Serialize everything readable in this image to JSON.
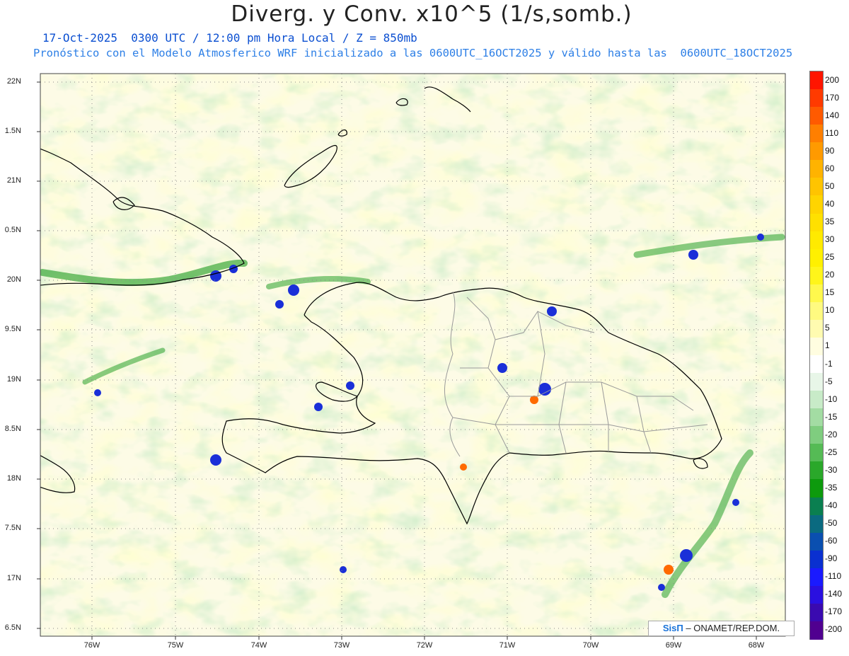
{
  "header": {
    "title": "Diverg. y Conv. x10^5 (1/s,somb.)",
    "subtitle1": "17-Oct-2025  0300 UTC / 12:00 pm Hora Local / Z = 850mb",
    "subtitle2": "Pronóstico con el Modelo Atmosferico WRF inicializado a las 0600UTC_16OCT2025 y válido hasta las  0600UTC_18OCT2025"
  },
  "axes": {
    "lat_labels": [
      "22N",
      "1.5N",
      "21N",
      "0.5N",
      "20N",
      "9.5N",
      "19N",
      "8.5N",
      "18N",
      "7.5N",
      "17N",
      "6.5N"
    ],
    "lon_labels": [
      "76W",
      "75W",
      "74W",
      "73W",
      "72W",
      "71W",
      "70W",
      "69W",
      "68W"
    ]
  },
  "colorbar": {
    "labels": [
      "200",
      "170",
      "140",
      "110",
      "90",
      "60",
      "50",
      "40",
      "35",
      "30",
      "25",
      "20",
      "15",
      "10",
      "5",
      "1",
      "-1",
      "-5",
      "-10",
      "-15",
      "-20",
      "-25",
      "-30",
      "-35",
      "-40",
      "-50",
      "-60",
      "-90",
      "-110",
      "-140",
      "-170",
      "-200"
    ],
    "colors": [
      "#ff1500",
      "#ff3a00",
      "#ff5a00",
      "#ff7f00",
      "#ff9a00",
      "#ffb300",
      "#ffc400",
      "#ffd400",
      "#ffe000",
      "#ffea00",
      "#fff000",
      "#fff51a",
      "#fff84d",
      "#fffa80",
      "#fffbb0",
      "#fffde0",
      "#ffffff",
      "#e8f6e8",
      "#c8ebc8",
      "#a3dca3",
      "#7fcd7f",
      "#55bb55",
      "#2aa82a",
      "#0d9a0d",
      "#0a7f50",
      "#0a6a80",
      "#0a4fb0",
      "#0a30d0",
      "#1a1aff",
      "#2a10e0",
      "#3a0ab0",
      "#500090"
    ]
  },
  "credit": {
    "logo": "SisΠ",
    "text": " – ONAMET/REP.DOM."
  }
}
